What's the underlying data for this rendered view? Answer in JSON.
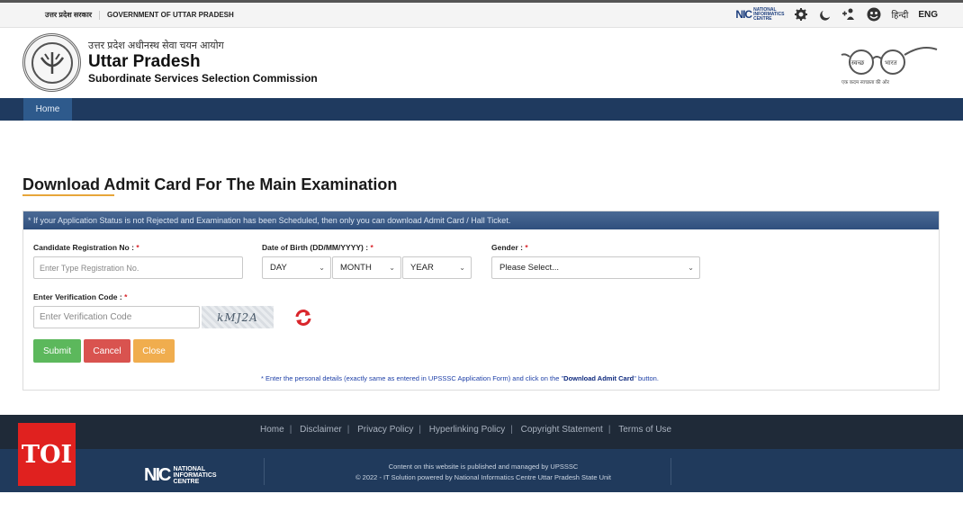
{
  "topbar": {
    "gov_hindi": "उत्तर प्रदेश सरकार",
    "gov_english": "GOVERNMENT OF UTTAR PRADESH",
    "nic_word": "NIC",
    "nic_text_1": "NATIONAL",
    "nic_text_2": "INFORMATICS",
    "nic_text_3": "CENTRE",
    "lang_hindi": "हिन्दी",
    "lang_english": "ENG",
    "icons": [
      "gear-icon",
      "moon-icon",
      "accessibility-icon",
      "contrast-icon"
    ]
  },
  "header": {
    "hindi_title": "उत्तर प्रदेश अधीनस्थ सेवा चयन आयोग",
    "title": "Uttar Pradesh",
    "subtitle": "Subordinate Services Selection Commission",
    "swachh_left": "स्वच्छ",
    "swachh_right": "भारत",
    "swachh_tag": "एक कदम स्वच्छता की ओर"
  },
  "nav": {
    "home": "Home"
  },
  "page": {
    "title": "Download Admit Card For The Main Examination",
    "notice": "* If your Application Status is not Rejected and Examination has been Scheduled, then only you can download Admit Card / Hall Ticket."
  },
  "form": {
    "reg_label": "Candidate Registration No :",
    "reg_placeholder": "Enter Type Registration No.",
    "dob_label": "Date of Birth (DD/MM/YYYY) :",
    "day": "DAY",
    "month": "MONTH",
    "year": "YEAR",
    "gender_label": "Gender :",
    "gender_value": "Please Select...",
    "code_label": "Enter Verification Code :",
    "code_placeholder": "Enter Verification Code",
    "captcha": "kMJ2A",
    "required_mark": "*",
    "submit": "Submit",
    "cancel": "Cancel",
    "close": "Close",
    "note_pre": "* Enter the personal details (exactly same as entered in UPSSSC Application Form) and click on the \"",
    "note_bold": "Download Admit Card",
    "note_post": "\" button."
  },
  "footer": {
    "links": [
      "Home",
      "Disclaimer",
      "Privacy Policy",
      "Hyperlinking Policy",
      "Copyright Statement",
      "Terms of Use"
    ],
    "nic_word": "NIC",
    "nic_1": "NATIONAL",
    "nic_2": "INFORMATICS",
    "nic_3": "CENTRE",
    "line1": "Content on this website is published and managed by UPSSSC",
    "line2": "© 2022 - IT Solution powered by National Informatics Centre Uttar Pradesh State Unit"
  },
  "watermark": "TOI",
  "colors": {
    "navbar": "#1f3a5f",
    "submit": "#5cb85c",
    "cancel": "#d9534f",
    "close": "#f0ad4e",
    "required": "#d9252b"
  }
}
